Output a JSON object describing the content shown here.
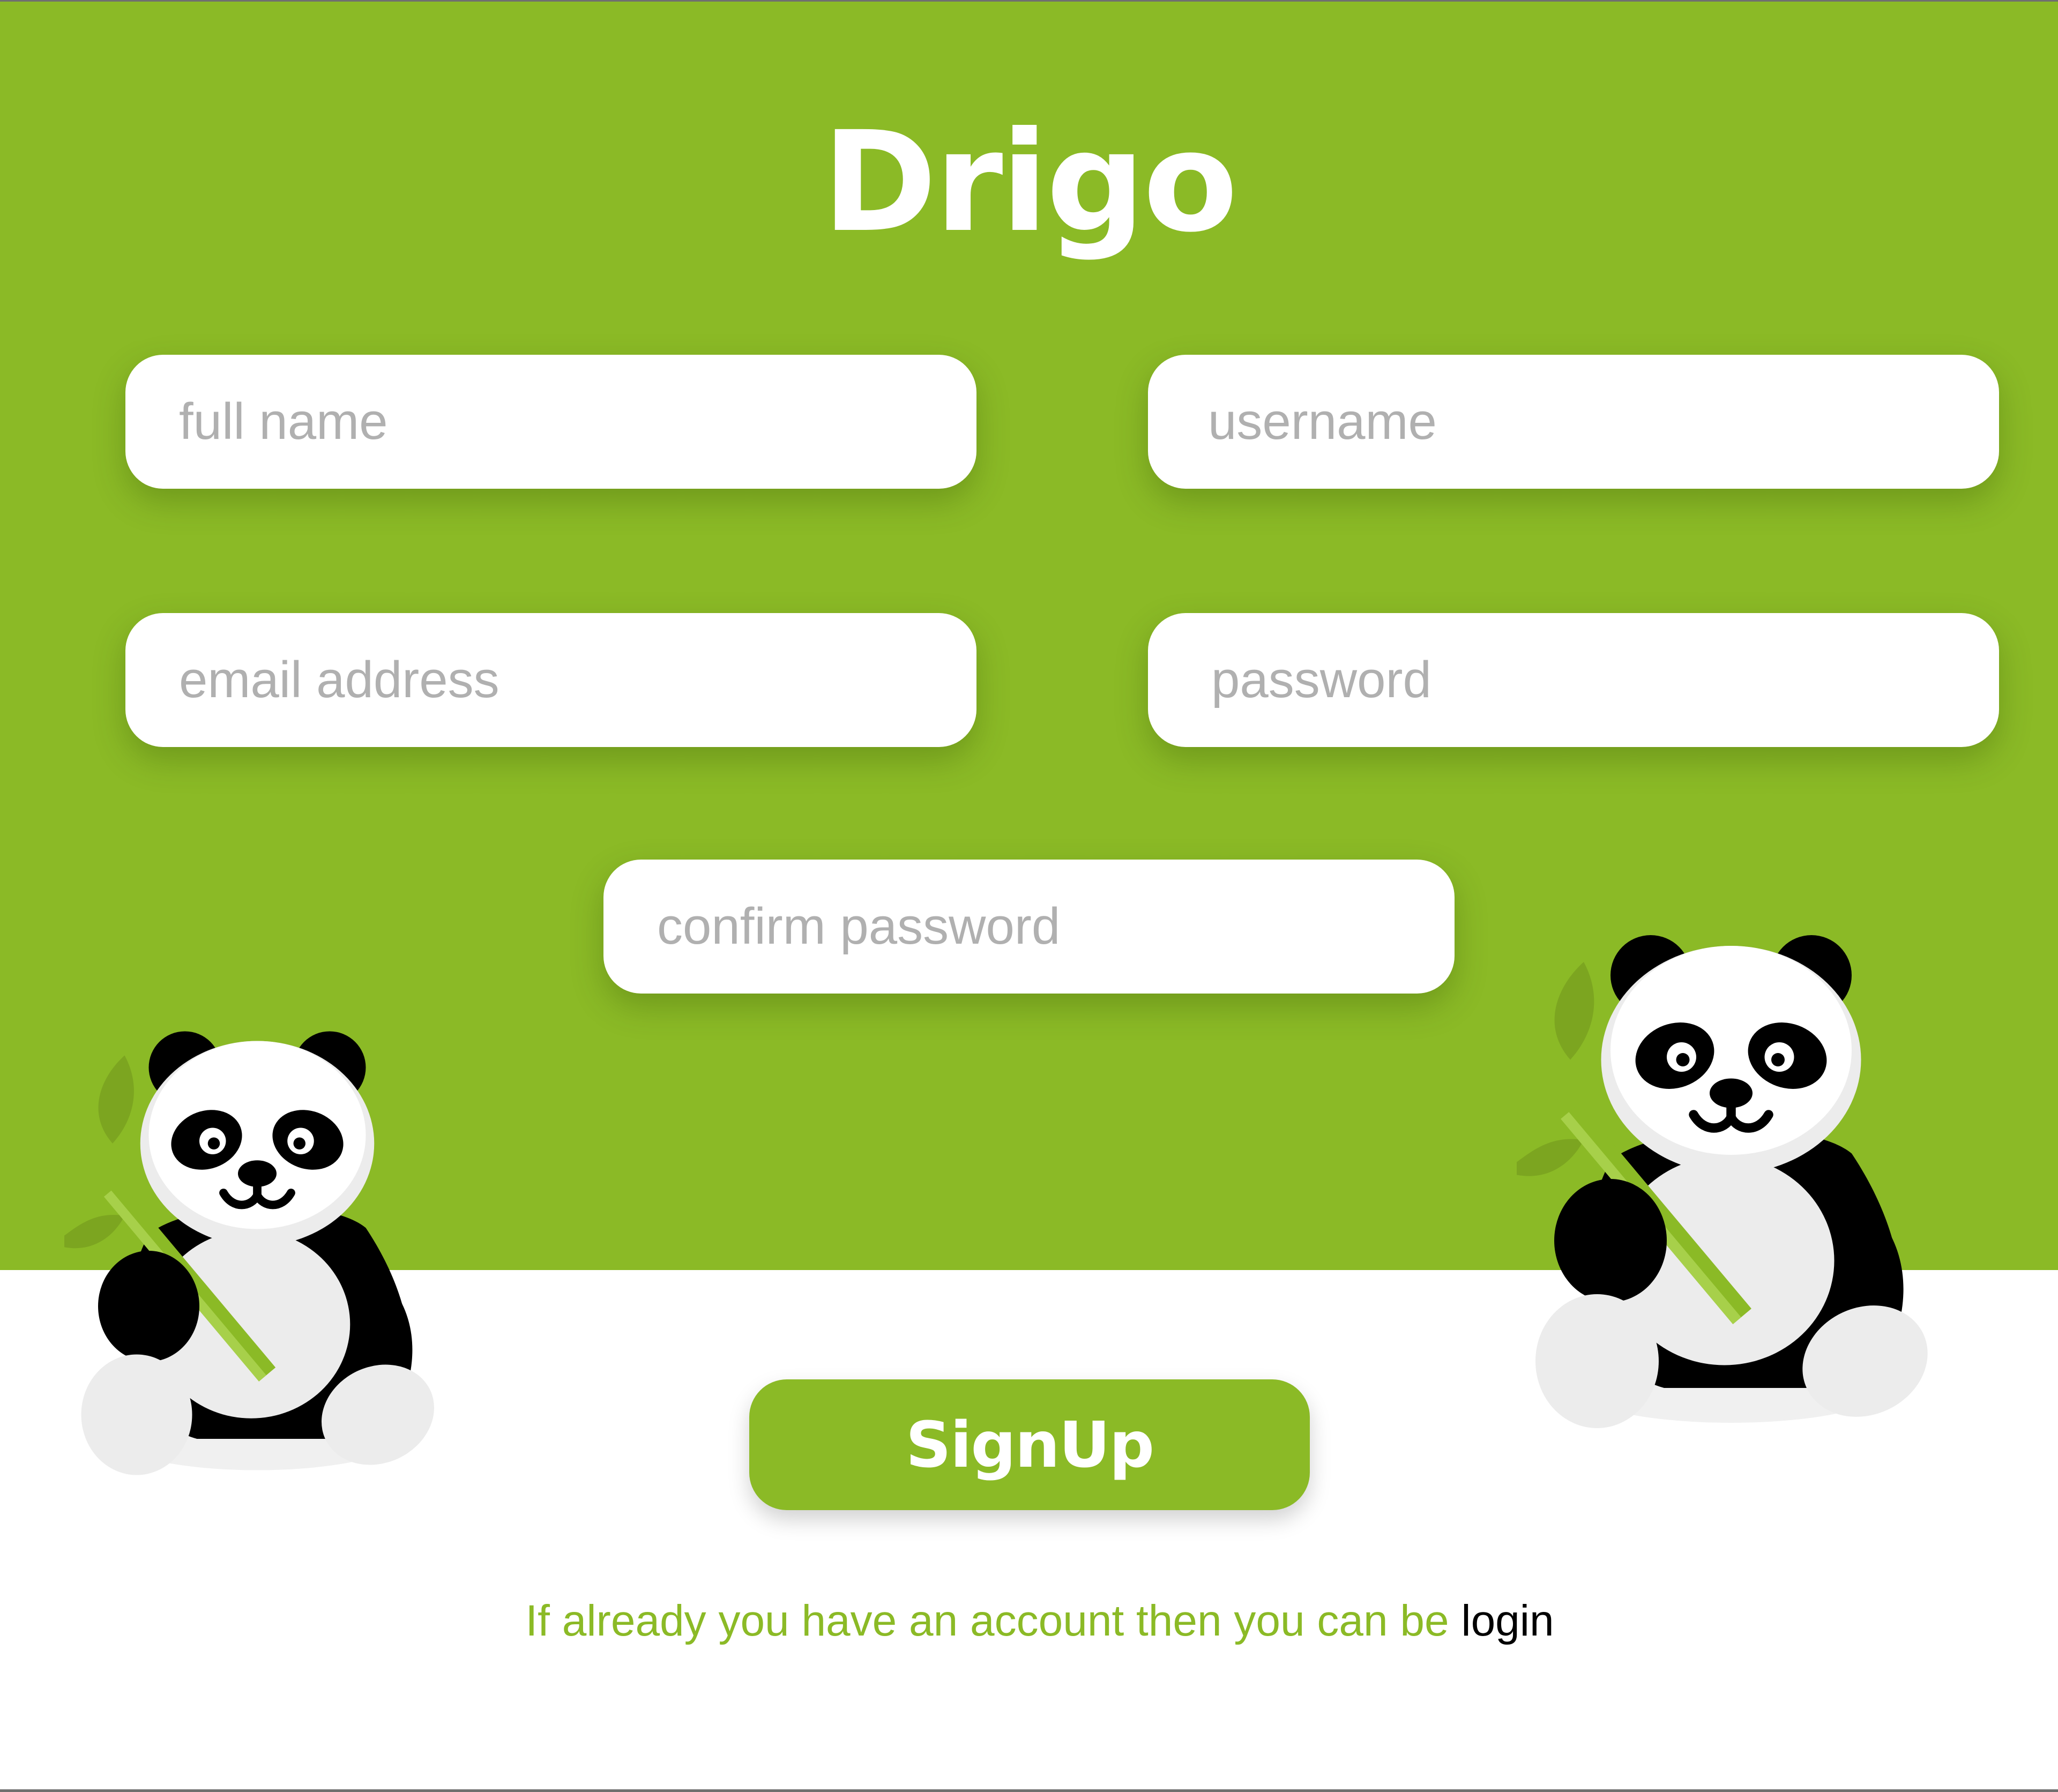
{
  "brand": {
    "title": "Drigo"
  },
  "form": {
    "full_name_placeholder": "full name",
    "username_placeholder": "username",
    "email_placeholder": "email address",
    "password_placeholder": "password",
    "confirm_password_placeholder": "confirm password",
    "signup_label": "SignUp"
  },
  "footer": {
    "prompt_text": "If already you have an account then you can be ",
    "login_label": "login"
  },
  "illustrations": {
    "left": "panda-with-bamboo-icon",
    "right": "panda-with-bamboo-icon"
  },
  "colors": {
    "accent": "#8bba26",
    "placeholder": "#b0b0b0",
    "background": "#ffffff",
    "panda_black": "#000000",
    "panda_white": "#ececec"
  }
}
